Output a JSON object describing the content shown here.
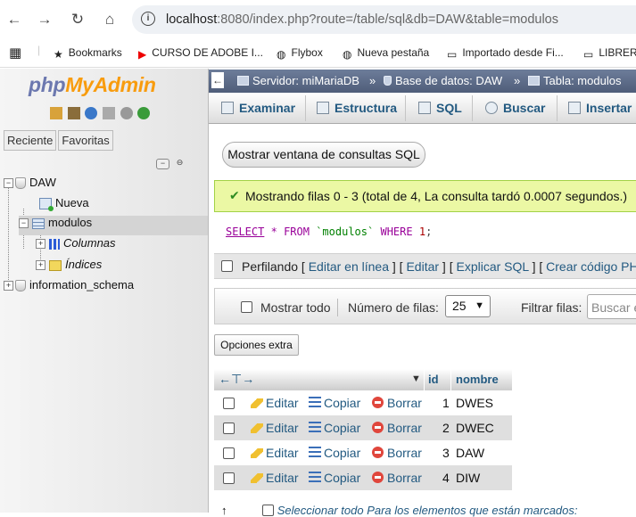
{
  "browser": {
    "url_host": "localhost",
    "url_rest": ":8080/index.php?route=/table/sql&db=DAW&table=modulos",
    "bookmarks": [
      "Bookmarks",
      "CURSO DE ADOBE I...",
      "Flybox",
      "Nueva pestaña",
      "Importado desde Fi...",
      "LIBRER"
    ]
  },
  "sidebar": {
    "logo_php": "php",
    "logo_myadmin": "MyAdmin",
    "tab_recent": "Reciente",
    "tab_favorites": "Favoritas",
    "tree": {
      "db": "DAW",
      "new": "Nueva",
      "table": "modulos",
      "columns": "Columnas",
      "indexes": "Índices",
      "other_db": "information_schema"
    }
  },
  "breadcrumb": {
    "server": "Servidor: miMariaDB",
    "database": "Base de datos: DAW",
    "table": "Tabla: modulos",
    "sep": "»"
  },
  "menu": [
    "Examinar",
    "Estructura",
    "SQL",
    "Buscar",
    "Insertar"
  ],
  "sql_window_button": "Mostrar ventana de consultas SQL",
  "success_message": "Mostrando filas 0 - 3 (total de 4, La consulta tardó 0.0007 segundos.)",
  "sql": {
    "select": "SELECT",
    "star": "*",
    "from": "FROM",
    "table": "`modulos`",
    "where": "WHERE",
    "value": "1",
    "end": ";"
  },
  "profiling": {
    "label": "Perfilando",
    "links": [
      "Editar en línea",
      "Editar",
      "Explicar SQL",
      "Crear código PHP"
    ]
  },
  "nav": {
    "show_all": "Mostrar todo",
    "rows_label": "Número de filas:",
    "rows_value": "25",
    "filter_label": "Filtrar filas:",
    "filter_placeholder": "Buscar en esta tabla"
  },
  "extra_options": "Opciones extra",
  "table": {
    "headers": [
      "id",
      "nombre"
    ],
    "actions": {
      "edit": "Editar",
      "copy": "Copiar",
      "delete": "Borrar"
    },
    "rows": [
      {
        "id": "1",
        "nombre": "DWES"
      },
      {
        "id": "2",
        "nombre": "DWEC"
      },
      {
        "id": "3",
        "nombre": "DAW"
      },
      {
        "id": "4",
        "nombre": "DIW"
      }
    ]
  },
  "bottom_text": "Seleccionar todo    Para los elementos que están marcados:"
}
